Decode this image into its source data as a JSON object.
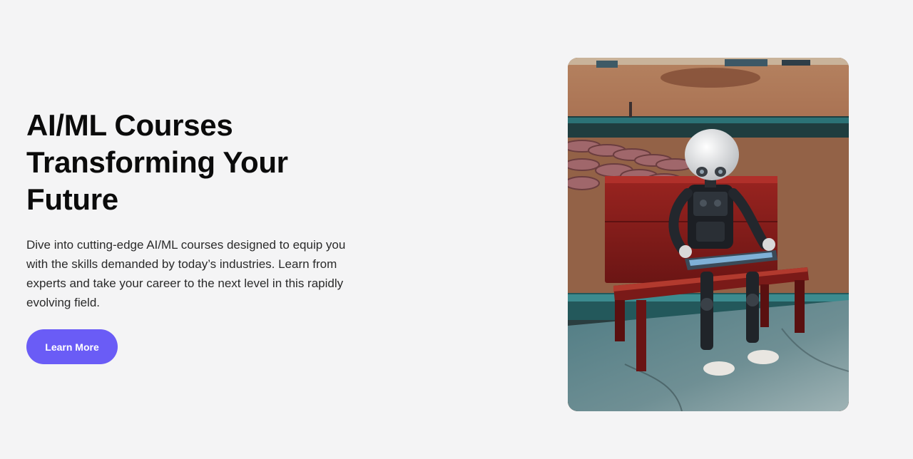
{
  "hero": {
    "title": "AI/ML Courses\nTransforming Your\nFuture",
    "description": "Dive into cutting-edge AI/ML courses designed to equip you with the skills demanded by today’s industries. Learn from experts and take your career to the next level in this rapidly evolving field.",
    "cta_label": "Learn More"
  },
  "image": {
    "subject": "humanoid robot sitting on a red wooden bench holding a tablet",
    "colors": {
      "accent": "#6a5cf6",
      "bench": "#8a1c1c",
      "field": "#9a5a3a",
      "floor": "#5f7f86",
      "rail": "#1e6a6e"
    }
  }
}
